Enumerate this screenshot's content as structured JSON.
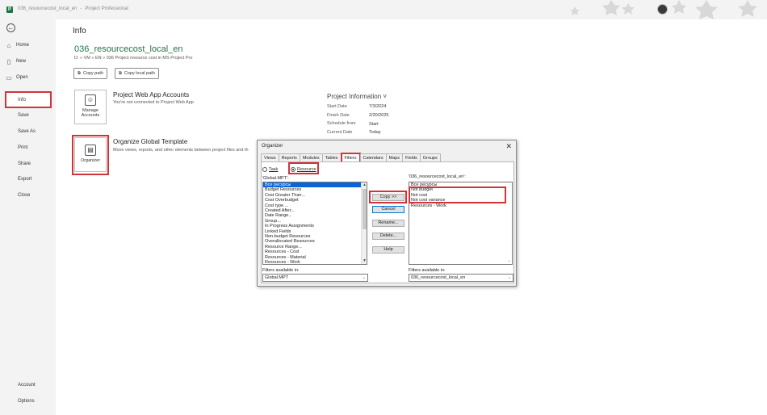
{
  "titlebar": {
    "app_icon": "P",
    "file_name": "036_resourcecost_local_en",
    "separator": "-",
    "app_name": "Project Professional"
  },
  "nav": {
    "back_icon": "back-arrow-icon",
    "items": [
      {
        "label": "Home",
        "icon": "home-icon"
      },
      {
        "label": "New",
        "icon": "new-file-icon"
      },
      {
        "label": "Open",
        "icon": "folder-open-icon"
      },
      {
        "label": "Info"
      },
      {
        "label": "Save"
      },
      {
        "label": "Save As"
      },
      {
        "label": "Print"
      },
      {
        "label": "Share"
      },
      {
        "label": "Export"
      },
      {
        "label": "Close"
      }
    ],
    "bottom": [
      {
        "label": "Account"
      },
      {
        "label": "Options"
      }
    ]
  },
  "main": {
    "title": "Info",
    "project_name": "036_resourcecost_local_en",
    "project_path": "D: » VM » EN » 036 Project resource cost in MS Project Pro",
    "copy_path": "Copy path",
    "copy_local_path": "Copy local path",
    "manage_accounts": {
      "line1": "Manage",
      "line2": "Accounts"
    },
    "pwa_title": "Project Web App Accounts",
    "pwa_desc": "You're not connected to Project Web App",
    "organizer_tile": "Organizer",
    "ogt_title": "Organize Global Template",
    "ogt_desc": "Move views, reports, and other elements between project files and th",
    "project_info": {
      "title": "Project Information ˅",
      "rows": [
        {
          "label": "Start Date",
          "value": "7/3/2024"
        },
        {
          "label": "Finish Date",
          "value": "2/20/2025"
        },
        {
          "label": "Schedule from",
          "value": "Start"
        },
        {
          "label": "Current Date",
          "value": "Today"
        }
      ]
    }
  },
  "organizer": {
    "title": "Organizer",
    "close": "✕",
    "tabs": [
      "Views",
      "Reports",
      "Modules",
      "Tables",
      "Filters",
      "Calendars",
      "Maps",
      "Fields",
      "Groups"
    ],
    "active_tab": "Filters",
    "radio_task": "Task",
    "radio_resource": "Resource",
    "left_label": "'Global.MPT':",
    "left_items": [
      "Все ресурсы",
      "Budget Resources",
      "Cost Greater Than...",
      "Cost Overbudget",
      "Cost type ...",
      "Created After...",
      "Date Range...",
      "Group...",
      "In Progress Assignments",
      "Linked Fields",
      "Non-budget Resources",
      "Overallocated Resources",
      "Resource Range...",
      "Resources - Cost",
      "Resources - Material",
      "Resources - Work"
    ],
    "right_label": "'036_resourcecost_local_en':",
    "right_items": [
      "Все ресурсы",
      "Not budget",
      "Not cost",
      "Not cost variance",
      "Resources - Work"
    ],
    "buttons": {
      "copy": "Copy >>",
      "cancel": "Cancel",
      "rename": "Rename...",
      "delete": "Delete...",
      "help": "Help"
    },
    "left_avail_label": "Filters available in:",
    "left_avail_value": "Global.MPT",
    "right_avail_label": "Filters available in:",
    "right_avail_value": "036_resourcecost_local_en"
  }
}
